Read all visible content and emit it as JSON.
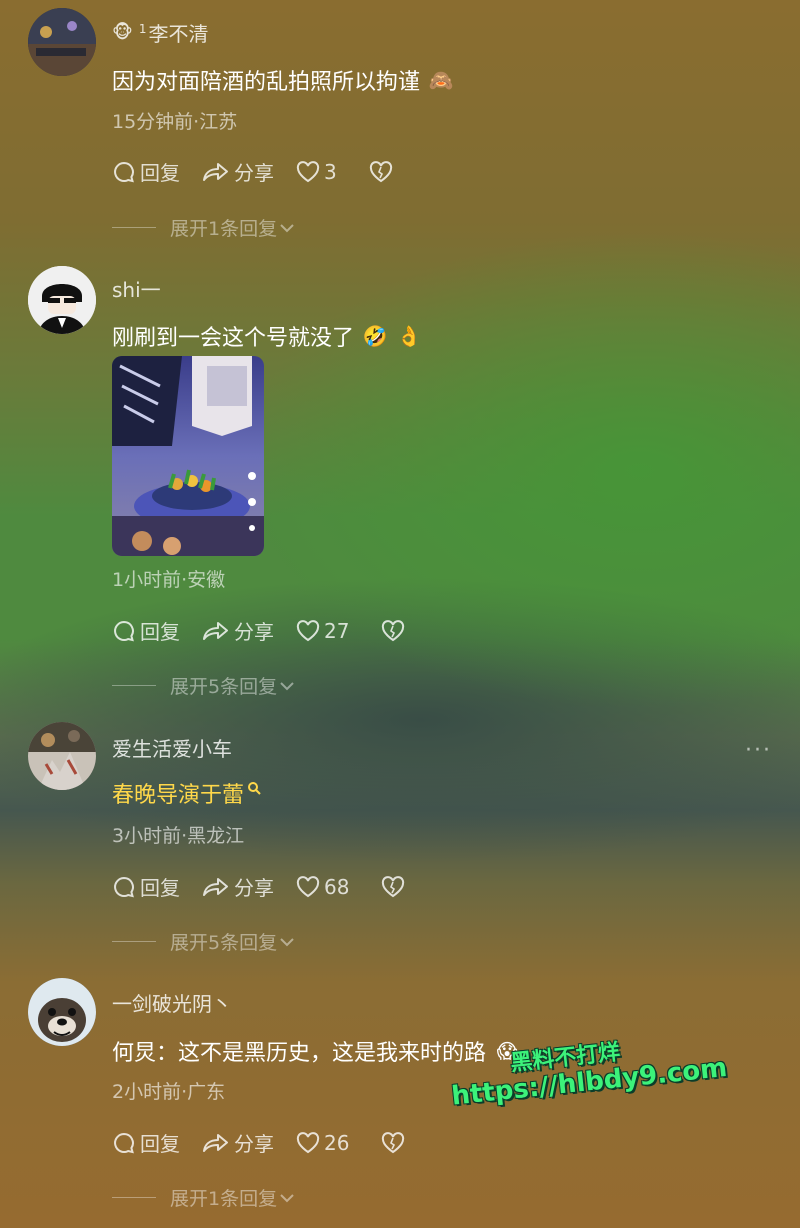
{
  "comments": [
    {
      "username": "李不清",
      "name_prefix_icon": "🐵",
      "name_superscript": "1",
      "text": "因为对面陪酒的乱拍照所以拘谨",
      "text_emoji": "🙈",
      "meta": "15分钟前·江苏",
      "reply_label": "回复",
      "share_label": "分享",
      "likes": "3",
      "expand_label": "展开1条回复"
    },
    {
      "username": "shi一",
      "text": "刚刷到一会这个号就没了",
      "text_emojis": [
        "🤣",
        "👌"
      ],
      "has_image": true,
      "meta": "1小时前·安徽",
      "reply_label": "回复",
      "share_label": "分享",
      "likes": "27",
      "expand_label": "展开5条回复"
    },
    {
      "username": "爱生活爱小车",
      "text": "春晚导演于蕾",
      "text_suffix_icon": "search-icon",
      "meta": "3小时前·黑龙江",
      "reply_label": "回复",
      "share_label": "分享",
      "likes": "68",
      "expand_label": "展开5条回复",
      "more_label": "···"
    },
    {
      "username": "一剑破光阴丶",
      "text": "何炅：这不是黑历史，这是我来时的路",
      "text_emoji": "😱",
      "meta": "2小时前·广东",
      "reply_label": "回复",
      "share_label": "分享",
      "likes": "26",
      "expand_label": "展开1条回复"
    }
  ],
  "watermark": {
    "line1": "黑料不打烊",
    "line2": "https://hlbdy9.com"
  },
  "colors": {
    "highlight_text": "#ffd84a",
    "watermark": "#3cf27a"
  }
}
